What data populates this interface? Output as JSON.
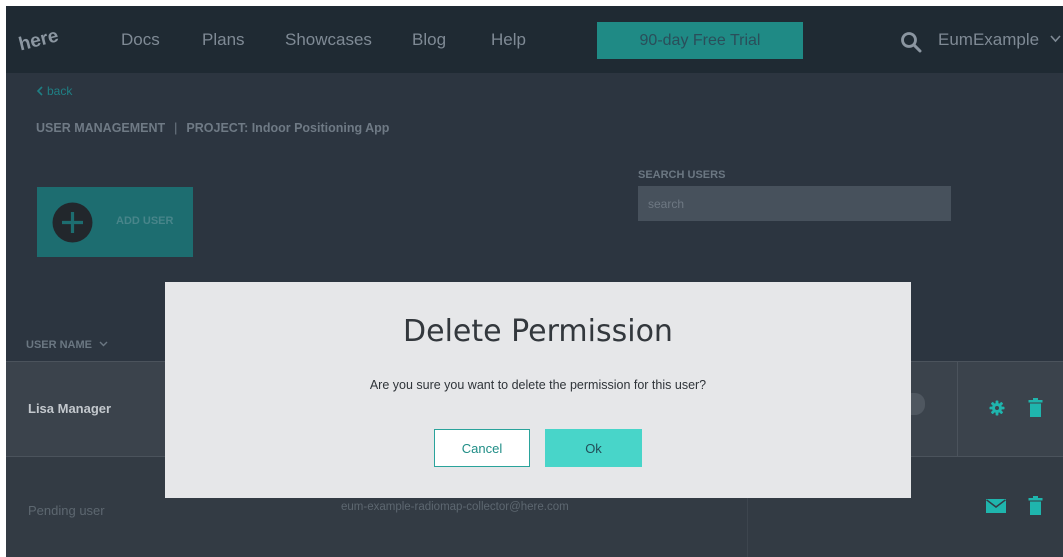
{
  "nav": {
    "logo_text": "here",
    "links": [
      "Docs",
      "Plans",
      "Showcases",
      "Blog",
      "Help"
    ],
    "trial_button": "90-day Free Trial",
    "search_icon": "search-icon",
    "user": "EumExample"
  },
  "page": {
    "back": "back",
    "breadcrumb": {
      "section": "USER MANAGEMENT",
      "separator": "|",
      "project": "PROJECT: Indoor Positioning App"
    },
    "add_user": "ADD USER",
    "search": {
      "label": "SEARCH USERS",
      "placeholder": "search"
    },
    "column_header": "USER NAME"
  },
  "table": {
    "rows": [
      {
        "name": "Lisa Manager",
        "email": "",
        "actions": [
          "gear-icon",
          "trash-icon"
        ]
      },
      {
        "name": "Pending user",
        "email": "eum-example-radiomap-collector@here.com",
        "actions": [
          "mail-icon",
          "trash-icon"
        ]
      }
    ]
  },
  "modal": {
    "title": "Delete Permission",
    "message": "Are you sure you want to delete the permission for this user?",
    "cancel": "Cancel",
    "ok": "Ok"
  },
  "colors": {
    "accent": "#48d5c9",
    "accent_dark": "#1f8a85",
    "nav_bg": "#1f2a33",
    "page_bg": "#2c3540",
    "modal_bg": "#e6e7e9"
  }
}
